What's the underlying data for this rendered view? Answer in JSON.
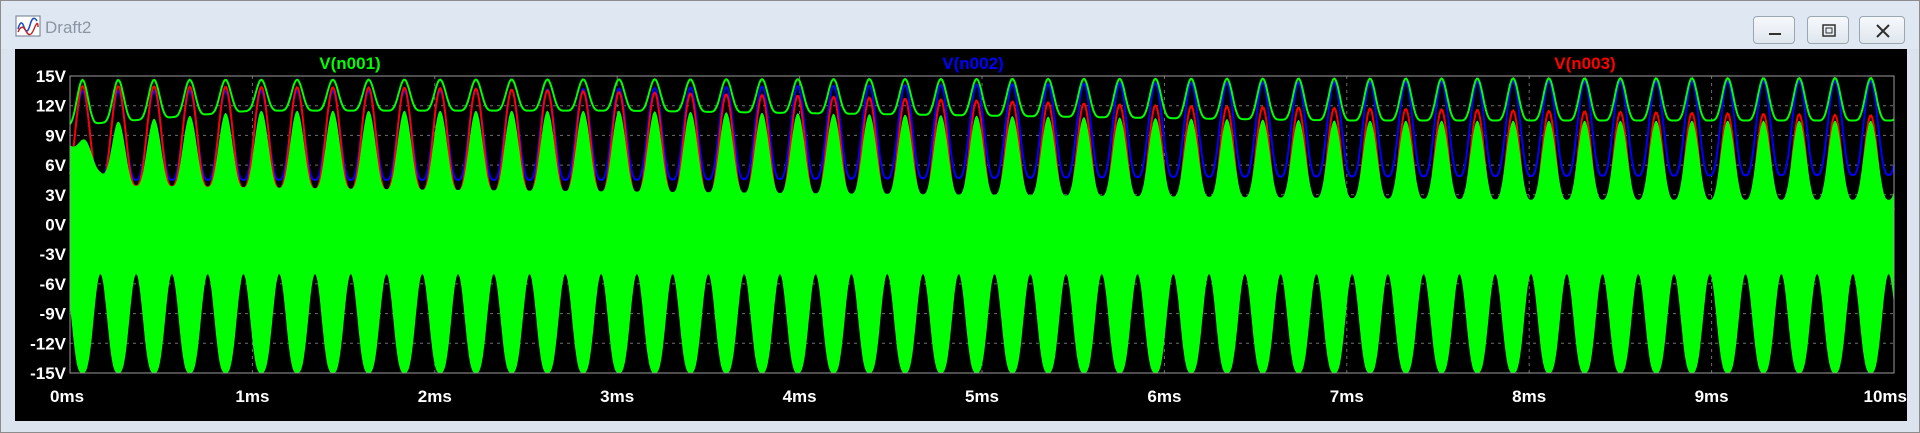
{
  "window": {
    "title": "Draft2"
  },
  "colors": {
    "n001": "#00ff00",
    "n002": "#0000ff",
    "n003": "#ff0000",
    "tick_text": "#ffffff",
    "grid": "#6f6f6f",
    "background": "#000000"
  },
  "chart_data": {
    "type": "line",
    "title": "",
    "xlabel": "",
    "ylabel": "",
    "xlim": [
      0,
      10
    ],
    "ylim": [
      -15,
      15
    ],
    "x_unit": "ms",
    "y_unit": "V",
    "grid": true,
    "x_ticks": [
      "0ms",
      "1ms",
      "2ms",
      "3ms",
      "4ms",
      "5ms",
      "6ms",
      "7ms",
      "8ms",
      "9ms",
      "10ms"
    ],
    "y_ticks": [
      "15V",
      "12V",
      "9V",
      "6V",
      "3V",
      "0V",
      "-3V",
      "-6V",
      "-9V",
      "-12V",
      "-15V"
    ],
    "legend": [
      "V(n001)",
      "V(n002)",
      "V(n003)"
    ],
    "cycles": 51,
    "series": [
      {
        "name": "V(n001)",
        "description_points": [
          {
            "x": 0,
            "min": -15,
            "max": 8
          },
          {
            "x": 0.3,
            "min": -15,
            "max": 14.5
          },
          {
            "x": 5,
            "min": -15,
            "max": 14.8
          },
          {
            "x": 10,
            "min": -15,
            "max": 14.8
          }
        ],
        "envelope_top": [
          [
            0,
            10
          ],
          [
            1,
            11.5
          ],
          [
            3,
            11.5
          ],
          [
            5,
            11
          ],
          [
            7,
            10.5
          ],
          [
            10,
            10.5
          ]
        ],
        "envelope_trough": [
          [
            0,
            4
          ],
          [
            2,
            3.5
          ],
          [
            5,
            3
          ],
          [
            8,
            2.5
          ],
          [
            10,
            2.5
          ]
        ],
        "lower_peak": [
          [
            0,
            -5
          ],
          [
            10,
            -5
          ]
        ]
      },
      {
        "name": "V(n002)",
        "peaks": [
          [
            0,
            13.5
          ],
          [
            2,
            13.5
          ],
          [
            4,
            14
          ],
          [
            6,
            14.3
          ],
          [
            8,
            14.5
          ],
          [
            10,
            14.5
          ]
        ],
        "troughs": [
          [
            0,
            4.5
          ],
          [
            3,
            4.5
          ],
          [
            6,
            4.8
          ],
          [
            10,
            5
          ]
        ]
      },
      {
        "name": "V(n003)",
        "peaks": [
          [
            0,
            14
          ],
          [
            2,
            13.8
          ],
          [
            4,
            13
          ],
          [
            6,
            12
          ],
          [
            8,
            11.5
          ],
          [
            10,
            11
          ]
        ],
        "troughs": [
          [
            0,
            4
          ],
          [
            3,
            3
          ],
          [
            5,
            2
          ],
          [
            7,
            1
          ],
          [
            10,
            0.5
          ]
        ]
      }
    ]
  }
}
